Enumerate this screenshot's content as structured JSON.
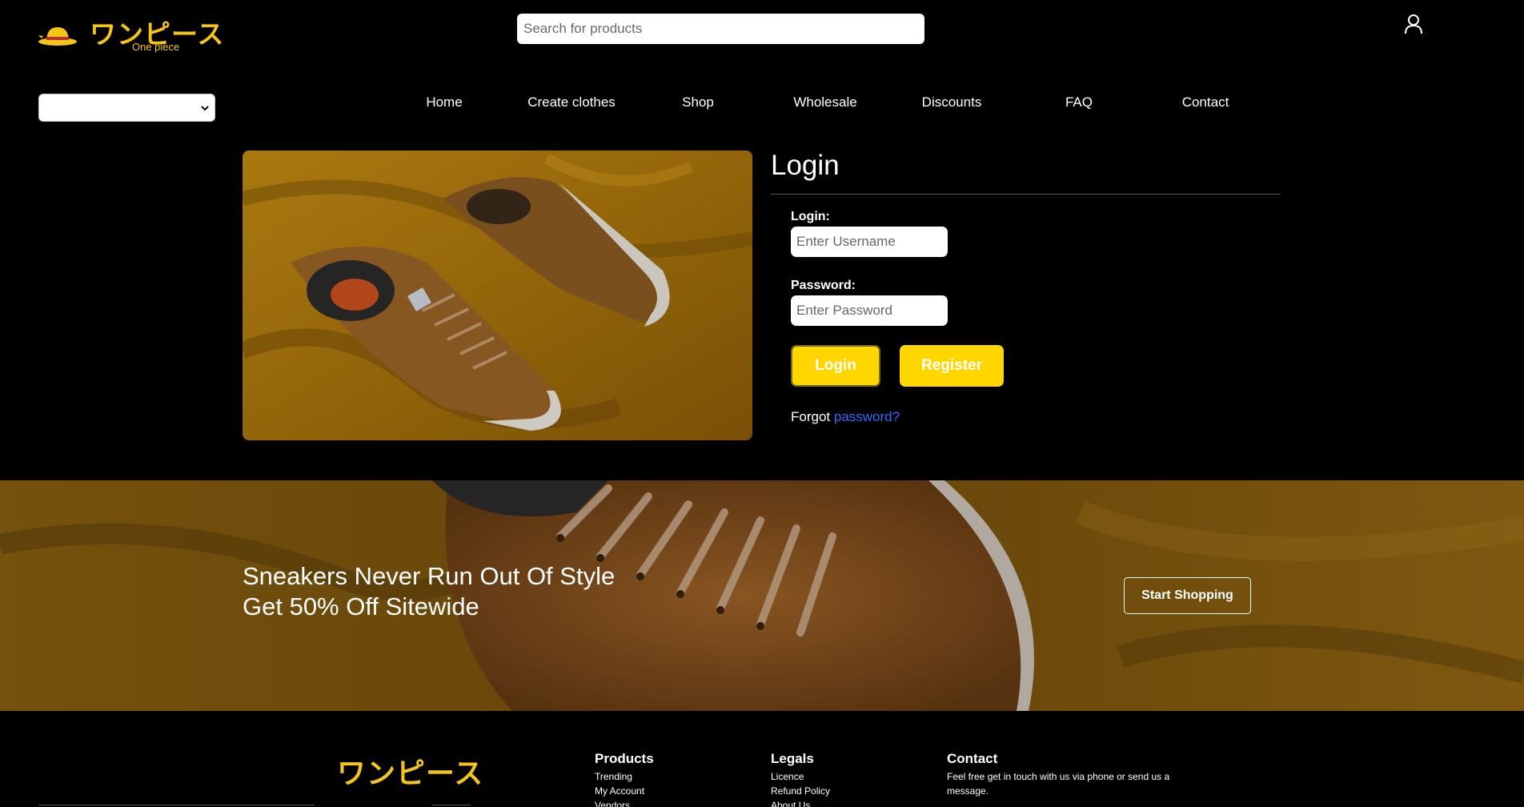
{
  "header": {
    "logo_text": "ワンピース",
    "logo_subtitle": "One piece",
    "search_placeholder": "Search for products",
    "user_icon": "user-icon",
    "language_select_value": ""
  },
  "nav": {
    "items": [
      {
        "label": "Home"
      },
      {
        "label": "Create clothes"
      },
      {
        "label": "Shop"
      },
      {
        "label": "Wholesale"
      },
      {
        "label": "Discounts"
      },
      {
        "label": "FAQ"
      },
      {
        "label": "Contact"
      }
    ]
  },
  "login": {
    "title": "Login",
    "username_label": "Login:",
    "username_placeholder": "Enter Username",
    "password_label": "Password:",
    "password_placeholder": "Enter Password",
    "login_button": "Login",
    "register_button": "Register",
    "forgot_text": "Forgot",
    "forgot_link": "password?"
  },
  "promo": {
    "line1": "Sneakers Never Run Out Of Style",
    "line2": "Get 50% Off Sitewide",
    "button": "Start Shopping"
  },
  "footer": {
    "logo_text": "ワンピース",
    "products": {
      "heading": "Products",
      "links": [
        "Trending",
        "My Account",
        "Vendors"
      ]
    },
    "legals": {
      "heading": "Legals",
      "links": [
        "Licence",
        "Refund Policy",
        "About Us"
      ]
    },
    "contact": {
      "heading": "Contact",
      "text": "Feel free get in touch with us via phone or send us a message."
    }
  },
  "colors": {
    "background": "#000000",
    "accent_yellow": "#ffd600",
    "logo_yellow": "#f5c518",
    "link_blue": "#2f6bff"
  }
}
